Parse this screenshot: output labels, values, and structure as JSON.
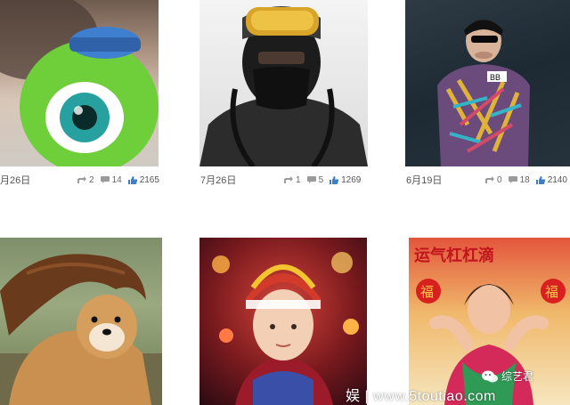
{
  "posts": [
    {
      "date": "月26日",
      "shares": "2",
      "comments": "14",
      "likes": "2165"
    },
    {
      "date": "7月26日",
      "shares": "1",
      "comments": "5",
      "likes": "1269"
    },
    {
      "date": "6月19日",
      "shares": "0",
      "comments": "18",
      "likes": "2140"
    }
  ],
  "photo_6_text": {
    "top": "运气杠杠滴",
    "left_charm": "福",
    "right_charm": "福"
  },
  "shirt_logo": "BB",
  "badge_text": "综艺君",
  "watermark": "娱 | www.5toutiao.com",
  "colors": {
    "like_blue": "#3b7ecb",
    "icon_gray": "#9a9a9a"
  }
}
